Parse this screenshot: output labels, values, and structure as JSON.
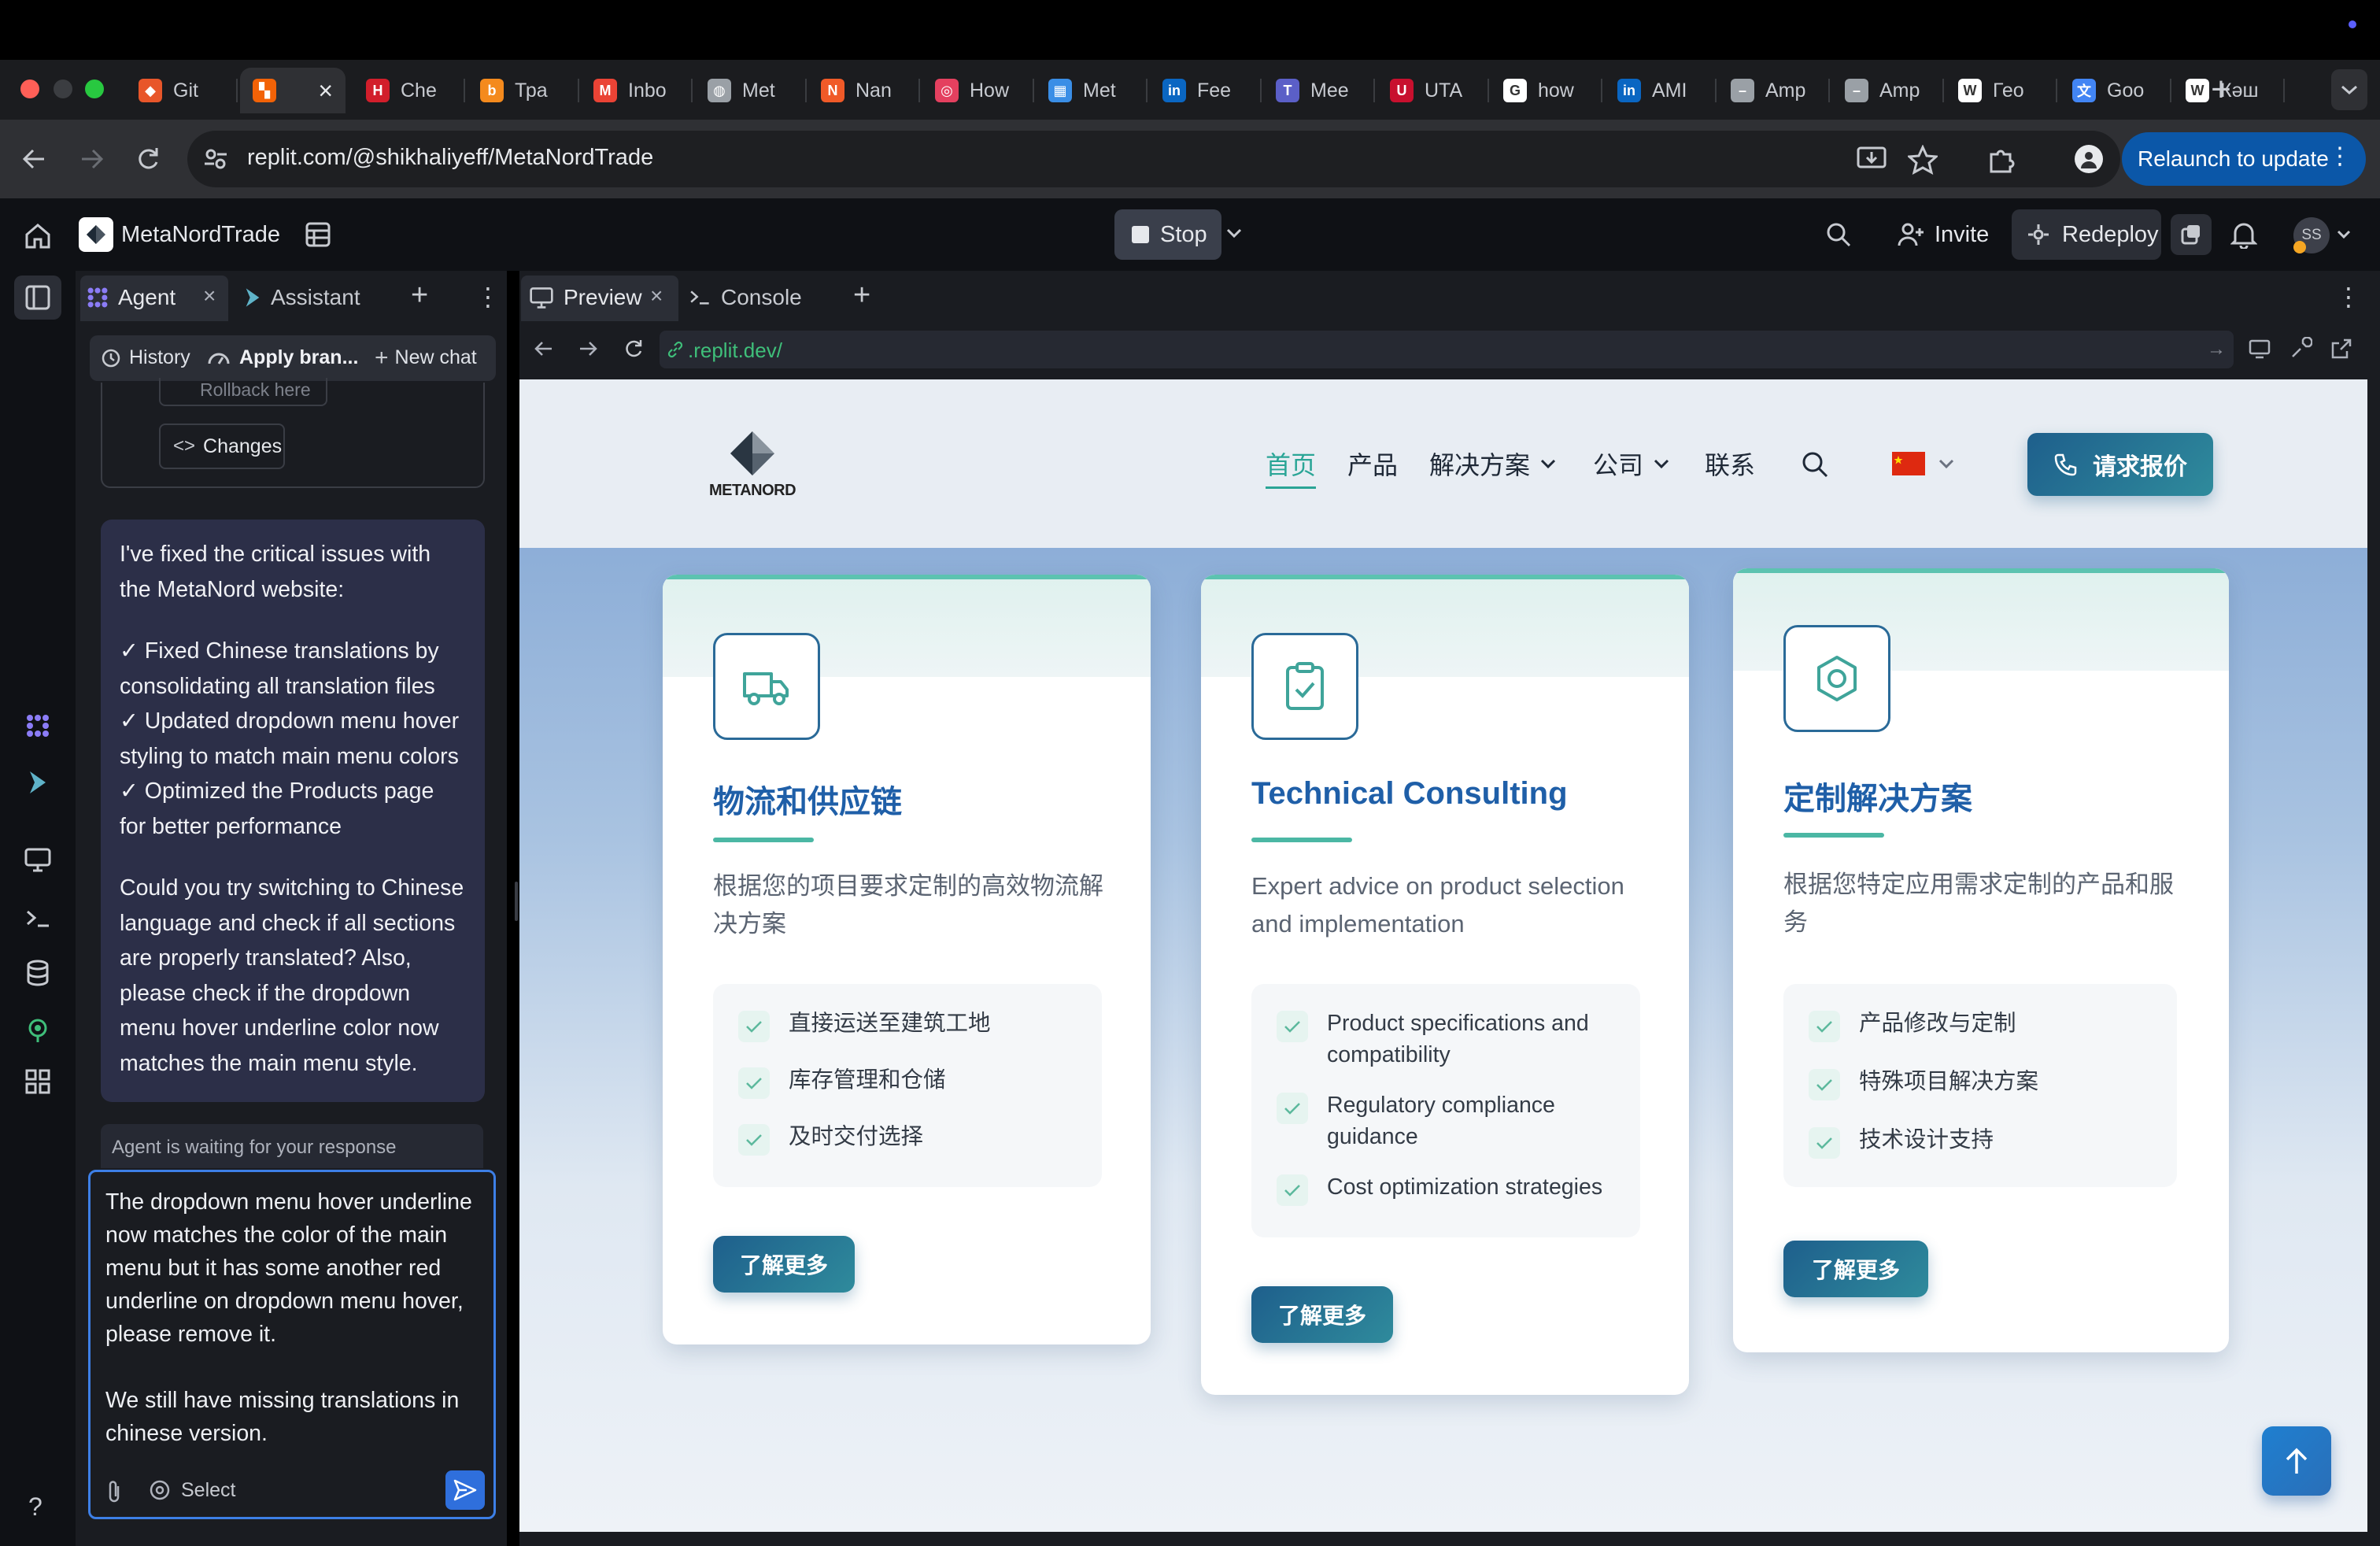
{
  "browser": {
    "tabs": [
      {
        "label": "Git",
        "icon": "git-icon",
        "color": "#e8562a"
      },
      {
        "label": "",
        "icon": "replit-icon",
        "color": "#f26207",
        "active": true
      },
      {
        "label": "Che",
        "icon": "h-icon",
        "color": "#d21e2b"
      },
      {
        "label": "Тра",
        "icon": "b-icon",
        "color": "#f48a1d"
      },
      {
        "label": "Inbo",
        "icon": "gmail-icon",
        "color": "#ea4335"
      },
      {
        "label": "Met",
        "icon": "globe-icon",
        "color": "#9aa0a6"
      },
      {
        "label": "Nan",
        "icon": "n-icon",
        "color": "#f05a28"
      },
      {
        "label": "How",
        "icon": "target-icon",
        "color": "#e4405f"
      },
      {
        "label": "Met",
        "icon": "grid-icon",
        "color": "#3a8ee6"
      },
      {
        "label": "Fee",
        "icon": "linkedin-icon",
        "color": "#0a66c2"
      },
      {
        "label": "Mee",
        "icon": "teams-icon",
        "color": "#5b5fc7"
      },
      {
        "label": "UTA",
        "icon": "uta-icon",
        "color": "#c8102e"
      },
      {
        "label": "how",
        "icon": "google-icon",
        "color": "#ffffff"
      },
      {
        "label": "AMI",
        "icon": "linkedin-icon",
        "color": "#0a66c2"
      },
      {
        "label": "Amp",
        "icon": "dash-icon",
        "color": "#9aa0a6"
      },
      {
        "label": "Amp",
        "icon": "dash-icon",
        "color": "#9aa0a6"
      },
      {
        "label": "Гео",
        "icon": "wikipedia-icon",
        "color": "#ffffff"
      },
      {
        "label": "Goo",
        "icon": "translate-icon",
        "color": "#4285f4"
      },
      {
        "label": "Кәш",
        "icon": "wikipedia-icon",
        "color": "#ffffff"
      }
    ],
    "url": "replit.com/@shikhaliyeff/MetaNordTrade",
    "relaunch_label": "Relaunch to update"
  },
  "replit": {
    "project_name": "MetaNordTrade",
    "stop_label": "Stop",
    "invite_label": "Invite",
    "redeploy_label": "Redeploy",
    "avatar_initials": "SS",
    "agent_tab": "Agent",
    "assistant_tab": "Assistant",
    "history_label": "History",
    "apply_label": "Apply bran...",
    "new_chat_label": "New chat",
    "rollback_label": "Rollback here",
    "changes_label": "Changes",
    "message": {
      "intro": "I've fixed the critical issues with the MetaNord website:",
      "fix1": "✓ Fixed Chinese translations by consolidating all translation files",
      "fix2": "✓ Updated dropdown menu hover styling to match main menu colors",
      "fix3": "✓ Optimized the Products page for better performance",
      "question": "Could you try switching to Chinese language and check if all sections are properly translated? Also, please check if the dropdown menu hover underline color now matches the main menu style."
    },
    "waiting_label": "Agent is waiting for your response",
    "composer_text": "The dropdown menu hover underline now matches the color of the main menu but it has some another red underline on dropdown menu hover, please remove it.\n\nWe still have missing translations in chinese version.",
    "select_label": "Select",
    "preview_tab": "Preview",
    "console_tab": "Console",
    "preview_url": ".replit.dev/",
    "help_label": "?"
  },
  "site": {
    "logo_text": "METANORD",
    "nav": {
      "home": "首页",
      "products": "产品",
      "solutions": "解决方案",
      "company": "公司",
      "contact": "联系"
    },
    "quote_button": "请求报价",
    "cards": [
      {
        "icon": "truck-icon",
        "title": "物流和供应链",
        "desc": "根据您的项目要求定制的高效物流解决方案",
        "features": [
          "直接运送至建筑工地",
          "库存管理和仓储",
          "及时交付选择"
        ],
        "button": "了解更多"
      },
      {
        "icon": "clipboard-check-icon",
        "title": "Technical Consulting",
        "desc": "Expert advice on product selection and implementation",
        "features": [
          "Product specifications and compatibility",
          "Regulatory compliance guidance",
          "Cost optimization strategies"
        ],
        "button": "了解更多"
      },
      {
        "icon": "hexagon-icon",
        "title": "定制解决方案",
        "desc": "根据您特定应用需求定制的产品和服务",
        "features": [
          "产品修改与定制",
          "特殊项目解决方案",
          "技术设计支持"
        ],
        "button": "了解更多"
      }
    ]
  }
}
